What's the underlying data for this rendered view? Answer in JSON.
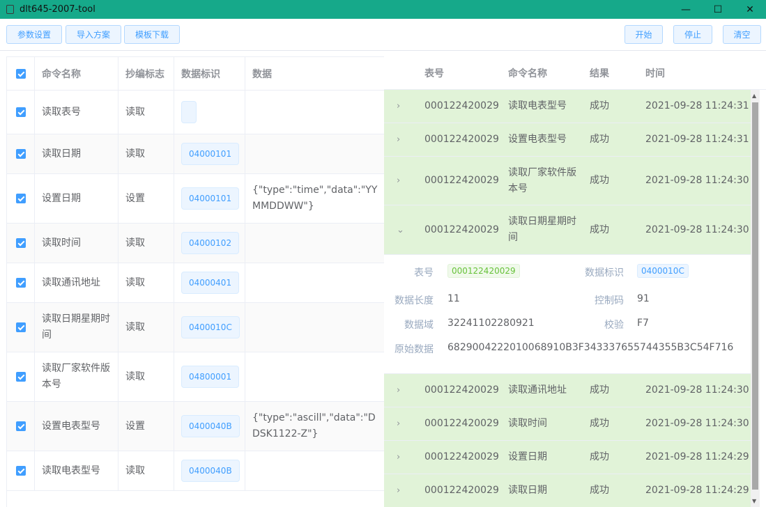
{
  "window": {
    "title": "dlt645-2007-tool",
    "minimize": "—",
    "maximize": "☐",
    "close": "✕"
  },
  "toolbar": {
    "params": "参数设置",
    "import": "导入方案",
    "template": "模板下载",
    "start": "开始",
    "stop": "停止",
    "clear": "清空"
  },
  "left_table": {
    "headers": {
      "name": "命令名称",
      "flag": "抄编标志",
      "id": "数据标识",
      "data": "数据"
    },
    "rows": [
      {
        "name": "读取表号",
        "flag": "读取",
        "id": "",
        "data": ""
      },
      {
        "name": "读取日期",
        "flag": "读取",
        "id": "04000101",
        "data": ""
      },
      {
        "name": "设置日期",
        "flag": "设置",
        "id": "04000101",
        "data": "{\"type\":\"time\",\"data\":\"YYMMDDWW\"}"
      },
      {
        "name": "读取时间",
        "flag": "读取",
        "id": "04000102",
        "data": ""
      },
      {
        "name": "读取通讯地址",
        "flag": "读取",
        "id": "04000401",
        "data": ""
      },
      {
        "name": "读取日期星期时间",
        "flag": "读取",
        "id": "0400010C",
        "data": ""
      },
      {
        "name": "读取厂家软件版本号",
        "flag": "读取",
        "id": "04800001",
        "data": ""
      },
      {
        "name": "设置电表型号",
        "flag": "设置",
        "id": "0400040B",
        "data": "{\"type\":\"ascill\",\"data\":\"DDSK1122-Z\"}"
      },
      {
        "name": "读取电表型号",
        "flag": "读取",
        "id": "0400040B",
        "data": ""
      }
    ]
  },
  "right_table": {
    "headers": {
      "meter": "表号",
      "name": "命令名称",
      "result": "结果",
      "time": "时间"
    },
    "rows": [
      {
        "meter": "000122420029",
        "name": "读取电表型号",
        "result": "成功",
        "time": "2021-09-28 11:24:31",
        "expanded": false
      },
      {
        "meter": "000122420029",
        "name": "设置电表型号",
        "result": "成功",
        "time": "2021-09-28 11:24:31",
        "expanded": false
      },
      {
        "meter": "000122420029",
        "name": "读取厂家软件版本号",
        "result": "成功",
        "time": "2021-09-28 11:24:30",
        "expanded": false
      },
      {
        "meter": "000122420029",
        "name": "读取日期星期时间",
        "result": "成功",
        "time": "2021-09-28 11:24:30",
        "expanded": true
      },
      {
        "meter": "000122420029",
        "name": "读取通讯地址",
        "result": "成功",
        "time": "2021-09-28 11:24:30",
        "expanded": false
      },
      {
        "meter": "000122420029",
        "name": "读取时间",
        "result": "成功",
        "time": "2021-09-28 11:24:30",
        "expanded": false
      },
      {
        "meter": "000122420029",
        "name": "设置日期",
        "result": "成功",
        "time": "2021-09-28 11:24:29",
        "expanded": false
      },
      {
        "meter": "000122420029",
        "name": "读取日期",
        "result": "成功",
        "time": "2021-09-28 11:24:29",
        "expanded": false
      }
    ],
    "detail": {
      "meter_label": "表号",
      "meter_value": "000122420029",
      "id_label": "数据标识",
      "id_value": "0400010C",
      "len_label": "数据长度",
      "len_value": "11",
      "ctrl_label": "控制码",
      "ctrl_value": "91",
      "field_label": "数据域",
      "field_value": "32241102280921",
      "check_label": "校验",
      "check_value": "F7",
      "raw_label": "原始数据",
      "raw_value": "6829004222010068910B3F343337655744355B3C54F716"
    }
  },
  "colors": {
    "titlebar": "#16a98a",
    "accent": "#409eff",
    "success_row": "#e1f3d8",
    "success_tag": "#67c23a"
  }
}
